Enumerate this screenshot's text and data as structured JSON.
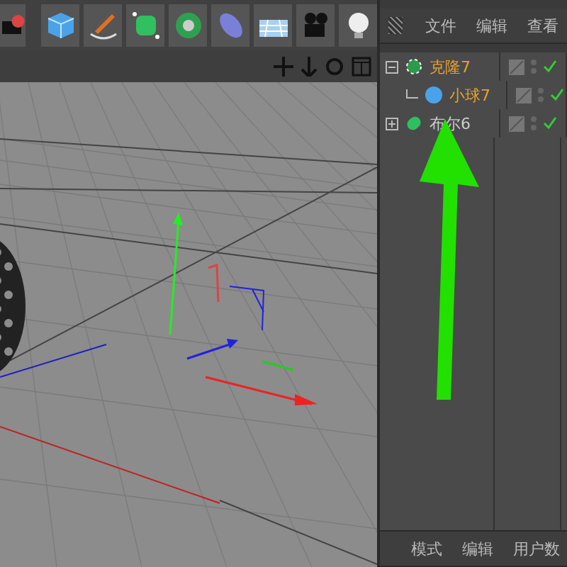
{
  "object_manager": {
    "menu": [
      "文件",
      "编辑",
      "查看"
    ],
    "objects": [
      {
        "name": "克隆7",
        "selected": true,
        "expanded": true,
        "enabled": true,
        "children": [
          {
            "name": "小球7",
            "selected": true,
            "enabled": true
          }
        ]
      },
      {
        "name": "布尔6",
        "selected": false,
        "expanded": false,
        "enabled": true
      }
    ]
  },
  "attribute_manager": {
    "menu": [
      "模式",
      "编辑",
      "用户数"
    ]
  }
}
